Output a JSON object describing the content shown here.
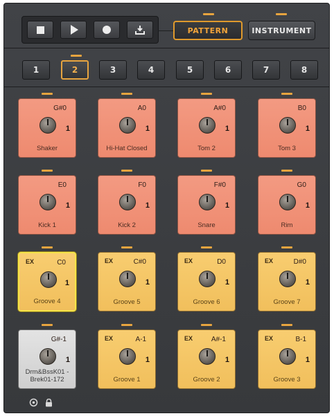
{
  "transport": {
    "stop_icon": "stop-icon",
    "play_icon": "play-icon",
    "record_icon": "record-icon",
    "export_icon": "export-icon"
  },
  "modes": {
    "pattern_label": "PATTERN",
    "instrument_label": "INSTRUMENT",
    "active": "PATTERN"
  },
  "banks": {
    "items": [
      "1",
      "2",
      "3",
      "4",
      "5",
      "6",
      "7",
      "8"
    ],
    "selected": "2"
  },
  "pads": [
    {
      "note": "G#0",
      "value": "1",
      "label": "Shaker",
      "color": "red",
      "ex": ""
    },
    {
      "note": "A0",
      "value": "1",
      "label": "Hi-Hat Closed",
      "color": "red",
      "ex": ""
    },
    {
      "note": "A#0",
      "value": "1",
      "label": "Tom 2",
      "color": "red",
      "ex": ""
    },
    {
      "note": "B0",
      "value": "1",
      "label": "Tom 3",
      "color": "red",
      "ex": ""
    },
    {
      "note": "E0",
      "value": "1",
      "label": "Kick 1",
      "color": "red",
      "ex": ""
    },
    {
      "note": "F0",
      "value": "1",
      "label": "Kick 2",
      "color": "red",
      "ex": ""
    },
    {
      "note": "F#0",
      "value": "1",
      "label": "Snare",
      "color": "red",
      "ex": ""
    },
    {
      "note": "G0",
      "value": "1",
      "label": "Rim",
      "color": "red",
      "ex": ""
    },
    {
      "note": "C0",
      "value": "1",
      "label": "Groove 4",
      "color": "yellow",
      "ex": "EX"
    },
    {
      "note": "C#0",
      "value": "1",
      "label": "Groove 5",
      "color": "yellow",
      "ex": "EX"
    },
    {
      "note": "D0",
      "value": "1",
      "label": "Groove 6",
      "color": "yellow",
      "ex": "EX"
    },
    {
      "note": "D#0",
      "value": "1",
      "label": "Groove 7",
      "color": "yellow",
      "ex": "EX"
    },
    {
      "note": "G#-1",
      "value": "1",
      "label": "Drm&BssK01 - Brek01-172",
      "color": "grey",
      "ex": ""
    },
    {
      "note": "A-1",
      "value": "1",
      "label": "Groove 1",
      "color": "yellow",
      "ex": "EX"
    },
    {
      "note": "A#-1",
      "value": "1",
      "label": "Groove 2",
      "color": "yellow",
      "ex": "EX"
    },
    {
      "note": "B-1",
      "value": "1",
      "label": "Groove 3",
      "color": "yellow",
      "ex": "EX"
    }
  ],
  "selected_pad": "Groove 4",
  "footer": {
    "icons": [
      "settings-icon",
      "lock-icon"
    ]
  },
  "colors": {
    "accent": "#e7a43f",
    "pad_red": "#f39a82",
    "pad_yellow": "#f8cd70",
    "pad_grey": "#e3e3e3",
    "selection": "#f5e44a",
    "background": "#3a3c3f"
  }
}
